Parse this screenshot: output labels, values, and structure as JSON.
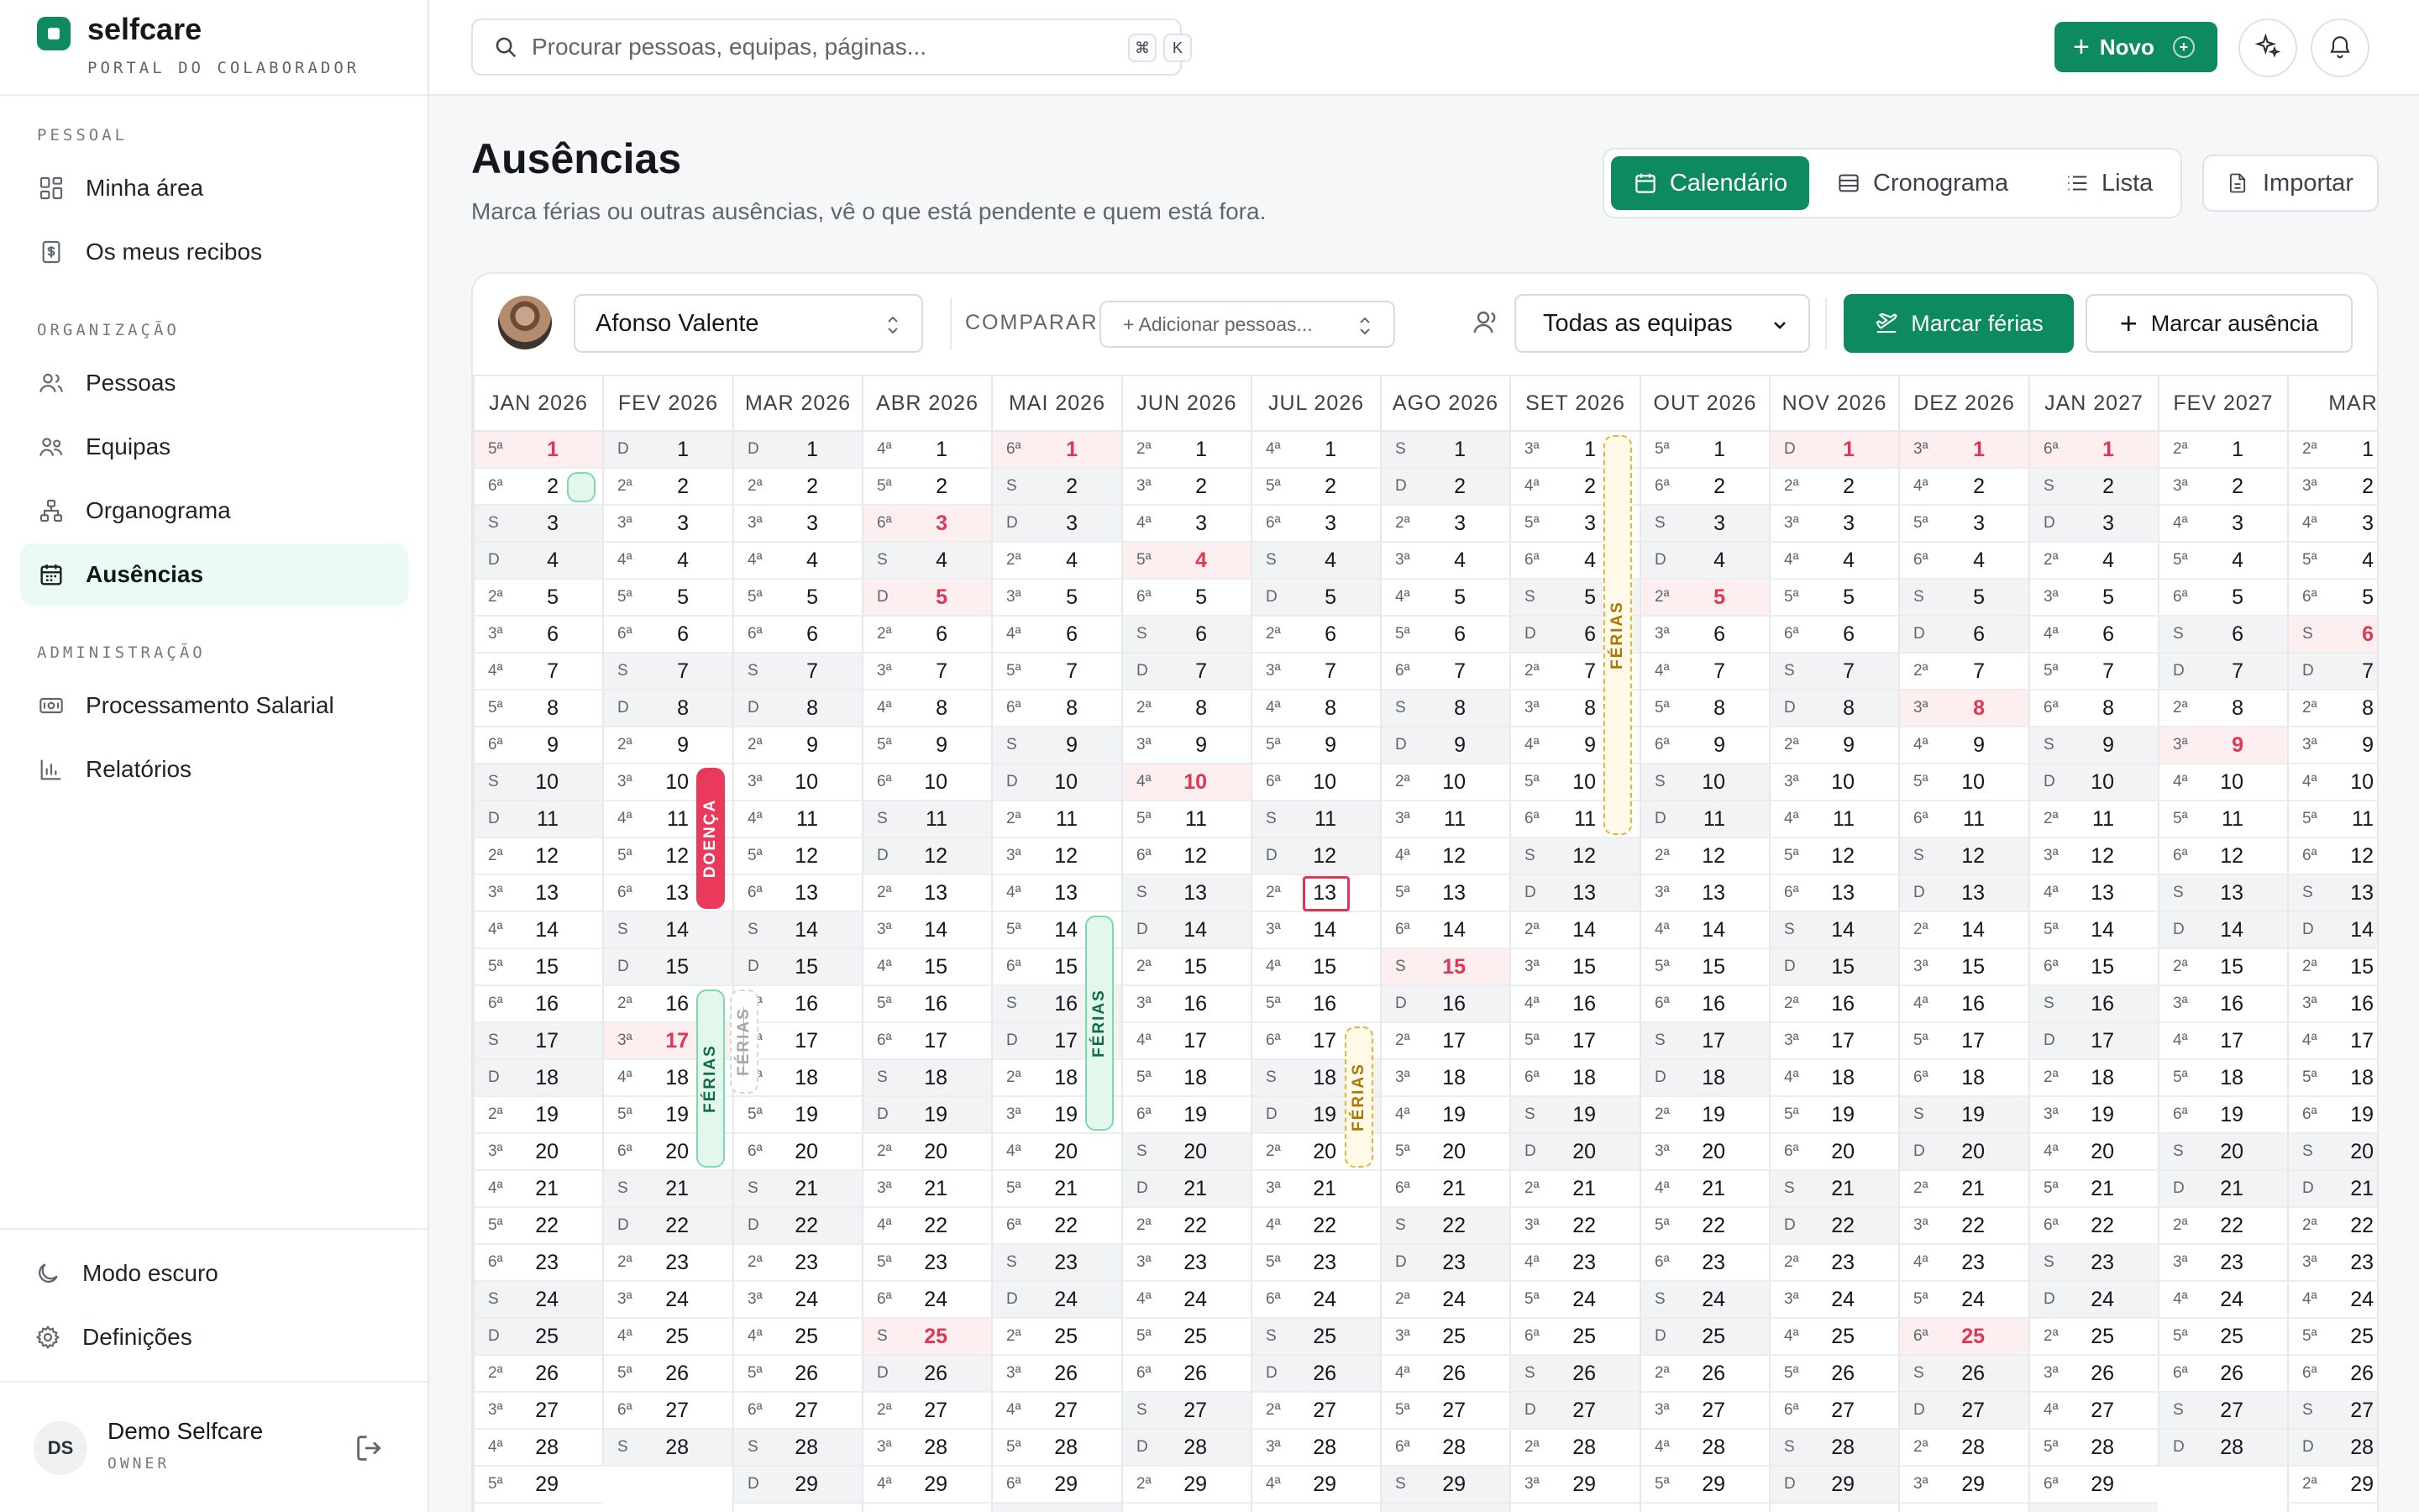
{
  "brand": {
    "name": "selfcare",
    "subtitle": "PORTAL DO COLABORADOR"
  },
  "sidebar": {
    "sections": [
      "PESSOAL",
      "ORGANIZAÇÃO",
      "ADMINISTRAÇÃO"
    ],
    "items": [
      {
        "label": "Minha área",
        "icon": "dashboard-icon"
      },
      {
        "label": "Os meus recibos",
        "icon": "receipt-icon"
      },
      {
        "label": "Pessoas",
        "icon": "users-icon"
      },
      {
        "label": "Equipas",
        "icon": "team-icon"
      },
      {
        "label": "Organograma",
        "icon": "org-chart-icon"
      },
      {
        "label": "Ausências",
        "icon": "calendar-icon",
        "active": true
      },
      {
        "label": "Processamento Salarial",
        "icon": "money-icon"
      },
      {
        "label": "Relatórios",
        "icon": "bar-chart-icon"
      }
    ],
    "bottom": [
      {
        "label": "Modo escuro",
        "icon": "moon-icon"
      },
      {
        "label": "Definições",
        "icon": "gear-icon"
      }
    ],
    "user": {
      "initials": "DS",
      "name": "Demo Selfcare",
      "role": "OWNER"
    }
  },
  "topbar": {
    "search_placeholder": "Procurar pessoas, equipas, páginas...",
    "shortcut": [
      "⌘",
      "K"
    ],
    "new_label": "Novo",
    "new_badge": "+"
  },
  "page": {
    "title": "Ausências",
    "subtitle": "Marca férias ou outras ausências, vê o que está pendente e quem está fora.",
    "views": [
      "Calendário",
      "Cronograma",
      "Lista"
    ],
    "active_view": "Calendário",
    "import_label": "Importar"
  },
  "toolbar": {
    "person": "Afonso Valente",
    "compare_label": "COMPARAR",
    "compare_placeholder": "+ Adicionar pessoas...",
    "team_filter": "Todas as equipas",
    "mark_vacation": "Marcar férias",
    "mark_absence": "Marcar ausência"
  },
  "calendar": {
    "months": [
      "JAN 2026",
      "FEV 2026",
      "MAR 2026",
      "ABR 2026",
      "MAI 2026",
      "JUN 2026",
      "JUL 2026",
      "AGO 2026",
      "SET 2026",
      "OUT 2026",
      "NOV 2026",
      "DEZ 2026",
      "JAN 2027",
      "FEV 2027",
      "MAR"
    ],
    "weekday_letters": [
      "D",
      "2ª",
      "3ª",
      "4ª",
      "5ª",
      "6ª",
      "S"
    ],
    "first_weekday": [
      4,
      0,
      0,
      3,
      5,
      1,
      3,
      6,
      2,
      4,
      0,
      2,
      5,
      1,
      1
    ],
    "days_in_month": [
      31,
      28,
      31,
      30,
      31,
      30,
      31,
      31,
      30,
      31,
      30,
      31,
      31,
      28,
      31
    ],
    "holidays": [
      [
        0,
        1
      ],
      [
        1,
        17
      ],
      [
        3,
        3
      ],
      [
        3,
        5
      ],
      [
        3,
        25
      ],
      [
        4,
        1
      ],
      [
        5,
        4
      ],
      [
        5,
        10
      ],
      [
        7,
        15
      ],
      [
        9,
        5
      ],
      [
        10,
        1
      ],
      [
        11,
        1
      ],
      [
        11,
        8
      ],
      [
        11,
        25
      ],
      [
        12,
        1
      ],
      [
        13,
        9
      ],
      [
        14,
        6
      ]
    ],
    "today": {
      "month": 6,
      "day": 13
    },
    "events": [
      {
        "month": 0,
        "start": 2,
        "end": 2,
        "label": "",
        "status": "approved"
      },
      {
        "month": 1,
        "start": 10,
        "end": 13,
        "label": "DOENÇA",
        "status": "sick"
      },
      {
        "month": 1,
        "start": 16,
        "end": 20,
        "label": "FÉRIAS",
        "status": "approved"
      },
      {
        "month": 1,
        "start": 16,
        "end": 18,
        "label": "FÉRIAS",
        "status": "cancelled",
        "lane": 1
      },
      {
        "month": 4,
        "start": 14,
        "end": 19,
        "label": "FÉRIAS",
        "status": "approved"
      },
      {
        "month": 6,
        "start": 17,
        "end": 20,
        "label": "FÉRIAS",
        "status": "pending"
      },
      {
        "month": 8,
        "start": 1,
        "end": 11,
        "label": "FÉRIAS",
        "status": "pending"
      }
    ]
  },
  "colors": {
    "brand": "#0d8a5f",
    "sick": "#ea3a5b",
    "holiday": "#e03553",
    "pending": "#e5b43a"
  }
}
